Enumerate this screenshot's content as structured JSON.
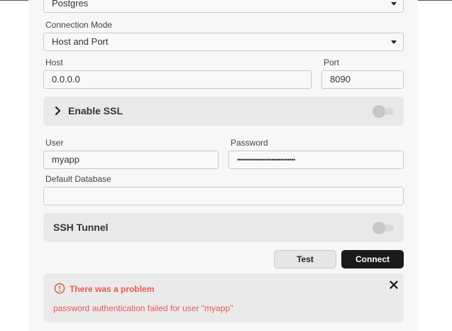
{
  "form": {
    "database_type": {
      "value": "Postgres"
    },
    "connection_mode": {
      "label": "Connection Mode",
      "value": "Host and Port"
    },
    "host": {
      "label": "Host",
      "value": "0.0.0.0"
    },
    "port": {
      "label": "Port",
      "value": "8090"
    },
    "ssl": {
      "title": "Enable SSL",
      "enabled": false
    },
    "user": {
      "label": "User",
      "value": "myapp"
    },
    "password": {
      "label": "Password",
      "value": "••••••••••••••••••••••••••••••••"
    },
    "default_database": {
      "label": "Default Database",
      "value": ""
    },
    "ssh": {
      "title": "SSH Tunnel",
      "enabled": false
    }
  },
  "actions": {
    "test_label": "Test",
    "connect_label": "Connect"
  },
  "alert": {
    "title": "There was a problem",
    "message": "password authentication failed for user \"myapp\"",
    "color": "#e35b4f"
  },
  "colors": {
    "accent": "#1a1a1a",
    "error": "#e35b4f"
  }
}
